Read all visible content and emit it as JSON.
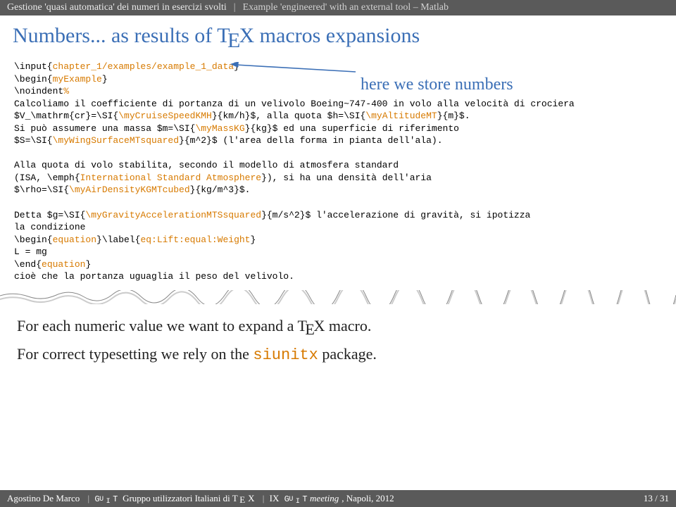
{
  "breadcrumb": {
    "part1": "Gestione 'quasi automatica' dei numeri in esercizi svolti",
    "part2": "Example 'engineered' with an external tool – Matlab"
  },
  "title": {
    "before": "Numbers... as results of T",
    "e": "E",
    "after": "X macros expansions"
  },
  "annotation": "here we store numbers",
  "code": {
    "l1a": "\\input{",
    "l1b": "chapter_1/examples/example_1_data",
    "l1c": "}",
    "l2a": "\\begin{",
    "l2b": "myExample",
    "l2c": "}",
    "l3a": "\\noindent",
    "l3b": "%",
    "l4": "Calcoliamo il coefficiente di portanza di un velivolo Boeing~747-400 in volo alla velocità di crociera",
    "l5a": "$V_\\mathrm{cr}=\\SI{",
    "l5b": "\\myCruiseSpeedKMH",
    "l5c": "}{km/h}$, alla quota $h=\\SI{",
    "l5d": "\\myAltitudeMT",
    "l5e": "}{m}$.",
    "l6a": "Si può assumere una massa $m=\\SI{",
    "l6b": "\\myMassKG",
    "l6c": "}{kg}$ ed una superficie di riferimento",
    "l7a": "$S=\\SI{",
    "l7b": "\\myWingSurfaceMTsquared",
    "l7c": "}{m^2}$ (l'area della forma in pianta dell'ala).",
    "l8": "",
    "l9": "Alla quota di volo stabilita, secondo il modello di atmosfera standard",
    "l10a": "(ISA, \\emph{",
    "l10b": "International Standard Atmosphere",
    "l10c": "}), si ha una densità dell'aria",
    "l11a": "$\\rho=\\SI{",
    "l11b": "\\myAirDensityKGMTcubed",
    "l11c": "}{kg/m^3}$.",
    "l12": "",
    "l13a": "Detta $g=\\SI{",
    "l13b": "\\myGravityAccelerationMTSsquared",
    "l13c": "}{m/s^2}$ l'accelerazione di gravità, si ipotizza",
    "l14": "la condizione",
    "l15a": "\\begin{",
    "l15b": "equation",
    "l15c": "}\\label{",
    "l15d": "eq:Lift:equal:Weight",
    "l15e": "}",
    "l16": "L = mg",
    "l17a": "\\end{",
    "l17b": "equation",
    "l17c": "}",
    "l18": "cioè che la portanza uguaglia il peso del velivolo."
  },
  "body": {
    "p1_before": "For each numeric value we want to expand a T",
    "p1_e": "E",
    "p1_after": "X macro.",
    "p2_before": "For correct typesetting we rely on the ",
    "p2_mono": "siunitx",
    "p2_after": " package."
  },
  "footer": {
    "author": "Agostino De Marco",
    "group_before": "Gruppo utilizzatori Italiani di T",
    "group_e": "E",
    "group_after": "X",
    "event": "IX",
    "meeting": "meeting",
    "place": ", Napoli, 2012",
    "page": "13 / 31"
  }
}
